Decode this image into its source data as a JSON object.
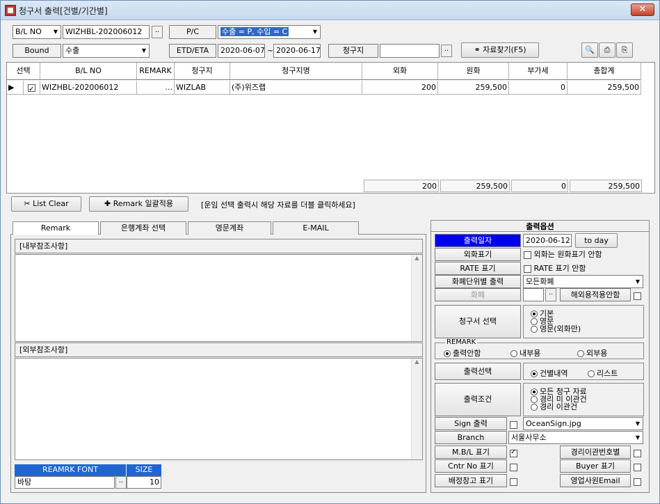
{
  "window": {
    "title": "청구서 출력[건별/기간별]",
    "close": "✕"
  },
  "toolbar": {
    "bl_type": "B/L NO",
    "bl_value": "WIZHBL-202006012",
    "pc_label": "P/C",
    "pc_value": "수출 = P, 수입 = C",
    "bound_label": "Bound",
    "bound_value": "수출",
    "etd_label": "ETD/ETA",
    "date_from": "2020-06-07",
    "date_sep": "~",
    "date_to": "2020-06-17",
    "billto_label": "청구지",
    "billto_value": "",
    "search_button": "자료찾기(F5)",
    "browse": ".."
  },
  "grid": {
    "columns": [
      "선택",
      "B/L NO",
      "REMARK",
      "청구지",
      "청구지명",
      "외화",
      "원화",
      "부가세",
      "총합계"
    ],
    "rows": [
      {
        "bl": "WIZHBL-202006012",
        "remark_btn": "...",
        "billto": "WIZLAB",
        "billto_name": "(주)위즈랩",
        "foreign": "200",
        "won": "259,500",
        "vat": "0",
        "total": "259,500"
      }
    ],
    "totals": {
      "foreign": "200",
      "won": "259,500",
      "vat": "0",
      "total": "259,500"
    }
  },
  "actions": {
    "list_clear": "List Clear",
    "remark_bulk": "Remark 일괄적용",
    "hint": "[운임 선택 출력시 해당 자료를 더블 클릭하세요]"
  },
  "tabs": [
    "Remark",
    "은행계좌 선택",
    "영문계좌",
    "E-MAIL"
  ],
  "remark": {
    "internal_label": "[내부참조사항]",
    "external_label": "[외부참조사항]",
    "font_header": "REAMRK FONT",
    "size_header": "SIZE",
    "font_value": "바탕",
    "size_value": "10"
  },
  "options": {
    "title": "출력옵션",
    "print_date_label": "출력일자",
    "print_date": "2020-06-12",
    "today_button": "to day",
    "foreign_label": "외화표기",
    "foreign_check": "외화는 원화표기 안함",
    "rate_label": "RATE 표기",
    "rate_check": "RATE 표기 안함",
    "currency_label": "화폐단위별 출력",
    "currency_value": "모든화폐",
    "currency2_label": "화폐",
    "overseas_label": "해외용적용안함",
    "invoice_label": "청구서 선택",
    "invoice_options": [
      "기본",
      "영문",
      "영문(외화만)"
    ],
    "remark_group": "REMARK",
    "remark_options": [
      "출력안함",
      "내부용",
      "외부용"
    ],
    "output_label": "출력선택",
    "output_options": [
      "건별내역",
      "리스트"
    ],
    "cond_label": "출력조건",
    "cond_options": [
      "모든 청구 자료",
      "경리 미 이관건",
      "경리   이관건"
    ],
    "sign_label": "Sign 출력",
    "sign_value": "OceanSign.jpg",
    "branch_label": "Branch",
    "branch_value": "서울사무소",
    "mbl_label": "M.B/L 표기",
    "cntr_label": "Cntr No 표기",
    "warehouse_label": "배정창고 표기",
    "transfer_no_label": "경리이관번호별",
    "buyer_label": "Buyer 표기",
    "sales_email_label": "영업사원Email"
  }
}
